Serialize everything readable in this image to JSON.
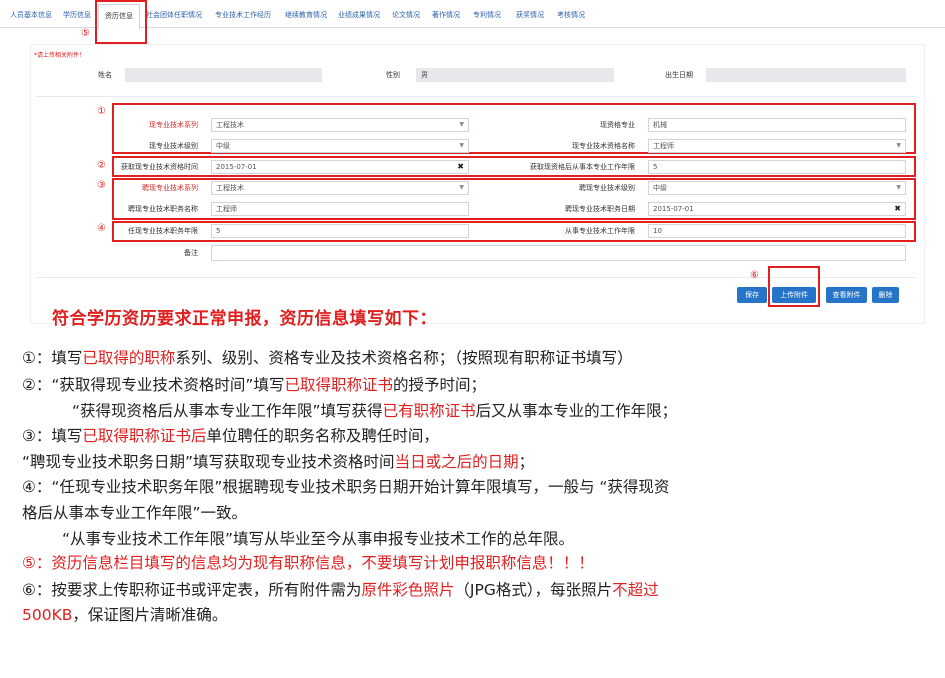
{
  "tabs": [
    {
      "label": "人员基本信息"
    },
    {
      "label": "学历信息"
    },
    {
      "label": "资历信息"
    },
    {
      "label": "社会团体任职情况"
    },
    {
      "label": "专业技术工作经历"
    },
    {
      "label": "继续教育情况"
    },
    {
      "label": "业绩成果情况"
    },
    {
      "label": "论文情况"
    },
    {
      "label": "著作情况"
    },
    {
      "label": "专利情况"
    },
    {
      "label": "获奖情况"
    },
    {
      "label": "考核情况"
    }
  ],
  "annotations": {
    "n1": "①",
    "n2": "②",
    "n3": "③",
    "n4": "④",
    "n5": "⑤",
    "n6": "⑥"
  },
  "form": {
    "required_note": "*请上传相关附件！",
    "name_label": "姓名",
    "name_value": "",
    "gender_label": "性别",
    "gender_value": "男",
    "birth_label": "出生日期",
    "birth_value": "",
    "series_label": "现专业技术系列",
    "series_value": "工程技术",
    "qual_major_label": "现资格专业",
    "qual_major_value": "机械",
    "level_label": "现专业技术级别",
    "level_value": "中级",
    "qual_name_label": "现专业技术资格名称",
    "qual_name_value": "工程师",
    "obtain_time_label": "获取现专业技术资格时间",
    "obtain_time_value": "2015-07-01",
    "years_after_label": "获取现资格后从事本专业工作年限",
    "years_after_value": "5",
    "hire_series_label": "聘现专业技术系列",
    "hire_series_value": "工程技术",
    "hire_level_label": "聘现专业技术级别",
    "hire_level_value": "中级",
    "hire_post_label": "聘现专业技术职务名称",
    "hire_post_value": "工程师",
    "hire_date_label": "聘现专业技术职务日期",
    "hire_date_value": "2015-07-01",
    "post_years_label": "任现专业技术职务年限",
    "post_years_value": "5",
    "work_years_label": "从事专业技术工作年限",
    "work_years_value": "10",
    "remark_label": "备注",
    "remark_value": ""
  },
  "buttons": {
    "save": "保存",
    "upload": "上传附件",
    "view": "查看附件",
    "delete": "删除"
  },
  "heading": "符合学历资历要求正常申报，资历信息填写如下：",
  "notes": {
    "l1a": "①：填写",
    "l1b": "已取得的职称",
    "l1c": "系列、级别、资格专业及技术资格名称；（按照现有职称证书填写）",
    "l2a": "②：“获取得现专业技术资格时间”填写",
    "l2b": "已取得职称证书",
    "l2c": "的授予时间；",
    "l3a": "“获得现资格后从事本专业工作年限”填写获得",
    "l3b": "已有职称证书",
    "l3c": "后又从事本专业的工作年限；",
    "l4a": "③：填写",
    "l4b": "已取得职称证书后",
    "l4c": "单位聘任的职务名称及聘任时间，",
    "l5a": "“聘现专业技术职务日期”填写获取现专业技术资格时间",
    "l5b": "当日或之后的日期",
    "l5c": "；",
    "l6": "④：“任现专业技术职务年限”根据聘现专业技术职务日期开始计算年限填写，一般与 “获得现资",
    "l7": "格后从事本专业工作年限”一致。",
    "l8": "“从事专业技术工作年限”填写从毕业至今从事申报专业技术工作的总年限。",
    "l9": "⑤：资历信息栏目填写的信息均为现有职称信息，不要填写计划申报职称信息！！！",
    "l10a": "⑥：按要求上传职称证书或评定表，所有附件需为",
    "l10b": "原件彩色照片",
    "l10c": "（JPG格式），每张照片",
    "l10d": "不超过",
    "l11a": "500KB",
    "l11b": "，保证图片清晰准确。"
  },
  "colors": {
    "accent": "#2574c8",
    "annotation": "#e02020"
  }
}
